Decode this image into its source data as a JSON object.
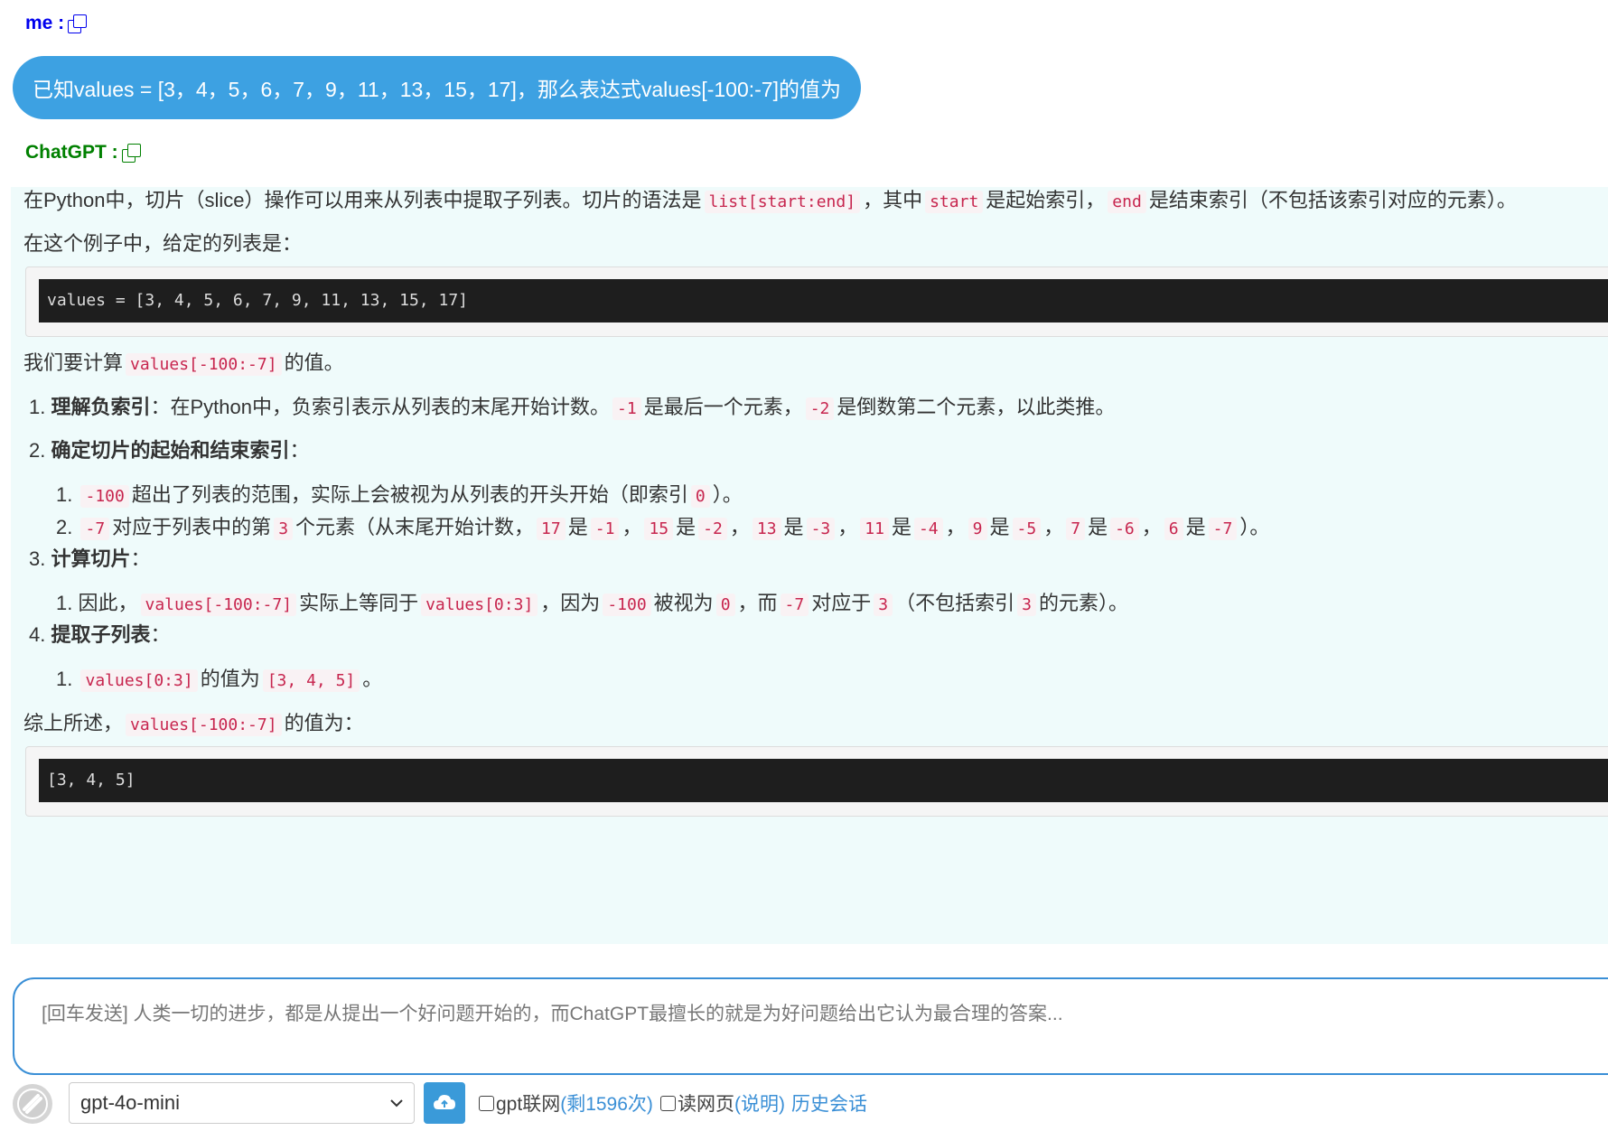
{
  "conversation": {
    "user_label": "me :",
    "assistant_label": "ChatGPT :",
    "question": "已知values = [3，4，5，6，7，9，11，13，15，17]，那么表达式values[-100:-7]的值为"
  },
  "answer": {
    "intro": {
      "t1": "在Python中，切片（slice）操作可以用来从列表中提取子列表。切片的语法是",
      "c1": "list[start:end]",
      "t2": "，其中",
      "c2": "start",
      "t3": "是起始索引，",
      "c3": "end",
      "t4": "是结束索引（不包括该索引对应的元素）。"
    },
    "given": "在这个例子中，给定的列表是：",
    "code_block_1": "values = [3, 4, 5, 6, 7, 9, 11, 13, 15, 17]",
    "compute": {
      "t1": "我们要计算",
      "c1": "values[-100:-7]",
      "t2": "的值。"
    },
    "step1": {
      "num": "1.",
      "title": "理解负索引",
      "t1": "：在Python中，负索引表示从列表的末尾开始计数。",
      "c1": "-1",
      "t2": "是最后一个元素，",
      "c2": "-2",
      "t3": "是倒数第二个元素，以此类推。"
    },
    "step2": {
      "num": "2.",
      "title": "确定切片的起始和结束索引",
      "colon": "：",
      "sub1": {
        "num": "1.",
        "c1": "-100",
        "t1": "超出了列表的范围，实际上会被视为从列表的开头开始（即索引",
        "c2": "0",
        "t2": "）。"
      },
      "sub2": {
        "num": "2.",
        "c1": "-7",
        "t1": "对应于列表中的第",
        "c2": "3",
        "t2": "个元素（从末尾开始计数，",
        "pairs": [
          {
            "a": "17",
            "b": "-1",
            "sep": "，"
          },
          {
            "a": "15",
            "b": "-2",
            "sep": "，"
          },
          {
            "a": "13",
            "b": "-3",
            "sep": "，"
          },
          {
            "a": "11",
            "b": "-4",
            "sep": "，"
          },
          {
            "a": "9",
            "b": "-5",
            "sep": "，"
          },
          {
            "a": "7",
            "b": "-6",
            "sep": "，"
          },
          {
            "a": "6",
            "b": "-7",
            "sep": "）。"
          }
        ],
        "is": "是"
      }
    },
    "step3": {
      "num": "3.",
      "title": "计算切片",
      "colon": "：",
      "sub1": {
        "num": "1.",
        "t1": "因此，",
        "c1": "values[-100:-7]",
        "t2": "实际上等同于",
        "c2": "values[0:3]",
        "t3": "，因为",
        "c3": "-100",
        "t4": "被视为",
        "c4": "0",
        "t5": "，而",
        "c5": "-7",
        "t6": "对应于",
        "c6": "3",
        "t7": "（不包括索引",
        "c7": "3",
        "t8": "的元素）。"
      }
    },
    "step4": {
      "num": "4.",
      "title": "提取子列表",
      "colon": "：",
      "sub1": {
        "num": "1.",
        "c1": "values[0:3]",
        "t1": "的值为",
        "c2": "[3, 4, 5]",
        "t2": "。"
      }
    },
    "summary": {
      "t1": "综上所述，",
      "c1": "values[-100:-7]",
      "t2": "的值为："
    },
    "code_block_2": "[3, 4, 5]"
  },
  "input": {
    "placeholder": "[回车发送] 人类一切的进步，都是从提出一个好问题开始的，而ChatGPT最擅长的就是为好问题给出它认为最合理的答案..."
  },
  "toolbar": {
    "model": "gpt-4o-mini",
    "web_search_label": "gpt联网",
    "web_search_remaining": "(剩1596次)",
    "read_page_label": "读网页",
    "read_page_help": "(说明)",
    "history": "历史会话"
  },
  "colors": {
    "bubble": "#3da1e2",
    "answer_bg": "#effbfb",
    "user_label": "#0000ee",
    "assistant_label": "#008000",
    "inline_code": "#c7254e"
  }
}
